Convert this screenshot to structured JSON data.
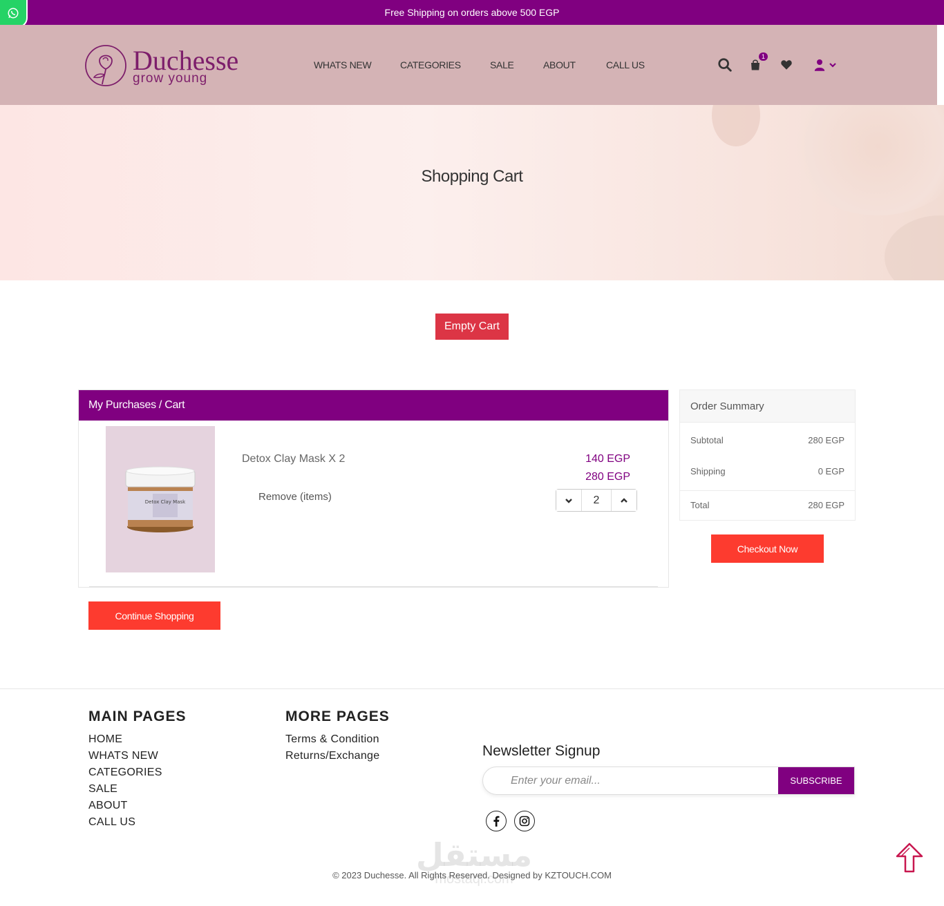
{
  "topbar": {
    "text": "Free Shipping on orders above 500 EGP"
  },
  "brand": {
    "name": "Duchesse",
    "tagline": "grow young"
  },
  "nav": [
    "WHATS NEW",
    "CATEGORIES",
    "SALE",
    "ABOUT",
    "CALL US"
  ],
  "header_icons": {
    "cart_count": "1"
  },
  "hero": {
    "title": "Shopping Cart"
  },
  "buttons": {
    "empty_cart": "Empty Cart",
    "checkout": "Checkout Now",
    "continue": "Continue Shopping"
  },
  "cart": {
    "heading": "My Purchases / Cart",
    "item": {
      "name": "Detox Clay Mask X 2",
      "remove_label": "Remove (items)",
      "unit_price": "140 EGP",
      "line_total": "280 EGP",
      "quantity": "2"
    }
  },
  "summary": {
    "heading": "Order Summary",
    "subtotal_label": "Subtotal",
    "subtotal_value": "280 EGP",
    "shipping_label": "Shipping",
    "shipping_value": "0 EGP",
    "total_label": "Total",
    "total_value": "280 EGP"
  },
  "footer": {
    "main_title": "MAIN PAGES",
    "main_links": [
      "HOME",
      "WHATS NEW",
      "CATEGORIES",
      "SALE",
      "ABOUT",
      "CALL US"
    ],
    "more_title": "MORE PAGES",
    "more_links": [
      "Terms & Condition",
      "Returns/Exchange"
    ],
    "newsletter_title": "Newsletter Signup",
    "newsletter_placeholder": "Enter your email...",
    "subscribe_label": "SUBSCRIBE",
    "copyright": "© 2023 Duchesse. All Rights Reserved. Designed by KZTOUCH.COM"
  },
  "watermark": {
    "arabic": "مستقل",
    "latin": "mostaql.com"
  },
  "colors": {
    "primary": "#800080",
    "header_bg": "#d4b3b5",
    "danger": "#dc3545",
    "cta": "#fd3b2f"
  }
}
